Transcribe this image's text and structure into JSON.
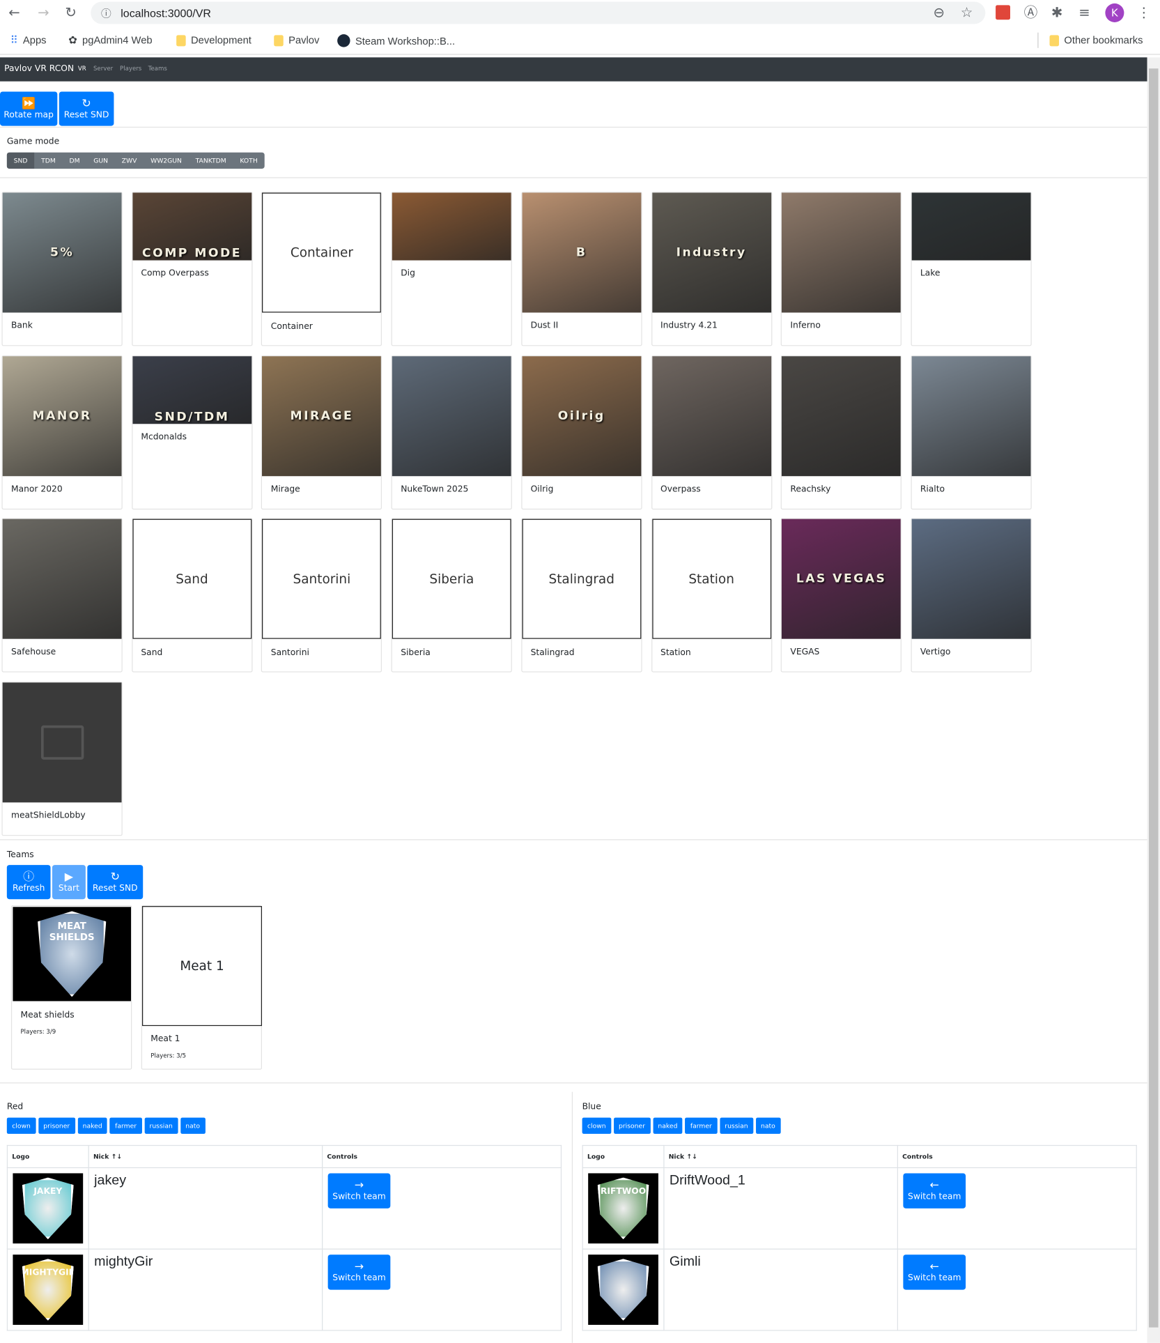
{
  "browser": {
    "url": "localhost:3000/VR",
    "profile_initial": "K",
    "bookmarks": [
      "Apps",
      "pgAdmin4 Web",
      "Development",
      "Pavlov",
      "Steam Workshop::B..."
    ],
    "other_bookmarks": "Other bookmarks"
  },
  "navbar": {
    "brand": "Pavlov VR RCON",
    "links": [
      "VR",
      "Server",
      "Players",
      "Teams"
    ],
    "active": "VR"
  },
  "actions": {
    "rotate_map": "Rotate map",
    "reset_snd": "Reset SND"
  },
  "game_mode": {
    "label": "Game mode",
    "modes": [
      "SND",
      "TDM",
      "DM",
      "GUN",
      "ZWV",
      "WW2GUN",
      "TANKTDM",
      "KOTH"
    ],
    "selected": "SND"
  },
  "maps": [
    {
      "name": "Bank",
      "thumb": "image",
      "color": "#7d8a8f",
      "text": "5%"
    },
    {
      "name": "Comp Overpass",
      "thumb": "short",
      "color": "#5a4536",
      "text": "COMP MODE"
    },
    {
      "name": "Container",
      "thumb": "placeholder"
    },
    {
      "name": "Dig",
      "thumb": "short",
      "color": "#8b5a34",
      "text": ""
    },
    {
      "name": "Dust II",
      "thumb": "image",
      "color": "#b99070",
      "text": "B"
    },
    {
      "name": "Industry 4.21",
      "thumb": "image",
      "color": "#5e5a52",
      "text": "Industry"
    },
    {
      "name": "Inferno",
      "thumb": "image",
      "color": "#8f7a6a",
      "text": ""
    },
    {
      "name": "Lake",
      "thumb": "short",
      "color": "#2e3436",
      "text": ""
    },
    {
      "name": "Manor 2020",
      "thumb": "image",
      "color": "#b0a894",
      "text": "MANOR"
    },
    {
      "name": "Mcdonalds",
      "thumb": "short",
      "color": "#3b3f4a",
      "text": "SND/TDM"
    },
    {
      "name": "Mirage",
      "thumb": "image",
      "color": "#8e7454",
      "text": "MIRAGE"
    },
    {
      "name": "NukeTown 2025",
      "thumb": "image",
      "color": "#5e6a78",
      "text": ""
    },
    {
      "name": "Oilrig",
      "thumb": "image",
      "color": "#8c6b4c",
      "text": "Oilrig"
    },
    {
      "name": "Overpass",
      "thumb": "image",
      "color": "#6f6660",
      "text": ""
    },
    {
      "name": "Reachsky",
      "thumb": "image",
      "color": "#4a4744",
      "text": ""
    },
    {
      "name": "Rialto",
      "thumb": "image",
      "color": "#7c8894",
      "text": ""
    },
    {
      "name": "Safehouse",
      "thumb": "image",
      "color": "#6a6862",
      "text": ""
    },
    {
      "name": "Sand",
      "thumb": "placeholder"
    },
    {
      "name": "Santorini",
      "thumb": "placeholder"
    },
    {
      "name": "Siberia",
      "thumb": "placeholder"
    },
    {
      "name": "Stalingrad",
      "thumb": "placeholder"
    },
    {
      "name": "Station",
      "thumb": "placeholder"
    },
    {
      "name": "VEGAS",
      "thumb": "image",
      "color": "#6a2a5a",
      "text": "LAS VEGAS"
    },
    {
      "name": "Vertigo",
      "thumb": "image",
      "color": "#5c6c82",
      "text": ""
    },
    {
      "name": "meatShieldLobby",
      "thumb": "missing",
      "color": "#3a3a3a",
      "text": ""
    }
  ],
  "teams": {
    "label": "Teams",
    "refresh": "Refresh",
    "start": "Start",
    "reset_snd": "Reset SND",
    "cards": [
      {
        "name": "Meat shields",
        "players": "Players: 3/9",
        "logo_text": "MEAT SHIELDS",
        "has_logo": true
      },
      {
        "name": "Meat 1",
        "players": "Players: 3/5",
        "has_logo": false
      }
    ]
  },
  "skins": [
    "clown",
    "prisoner",
    "naked",
    "farmer",
    "russian",
    "nato"
  ],
  "columns": {
    "logo": "Logo",
    "nick": "Nick ↑↓",
    "controls": "Controls"
  },
  "red": {
    "label": "Red",
    "players": [
      {
        "nick": "jakey",
        "logo_text": "JAKEY",
        "color": "#5cc8d0"
      },
      {
        "nick": "mightyGir",
        "logo_text": "MIGHTYGIR",
        "color": "#e8c020"
      }
    ],
    "switch_label": "Switch team",
    "arrow": "→"
  },
  "blue": {
    "label": "Blue",
    "players": [
      {
        "nick": "DriftWood_1",
        "logo_text": "DRIFTWOOD",
        "color": "#4a8a4a"
      },
      {
        "nick": "Gimli",
        "logo_text": "",
        "color": "#6a8ab0"
      }
    ],
    "switch_label": "Switch team",
    "arrow": "←"
  },
  "colors": {
    "primary": "#007bff",
    "navbar": "#343a40",
    "secondary": "#6c757d"
  }
}
